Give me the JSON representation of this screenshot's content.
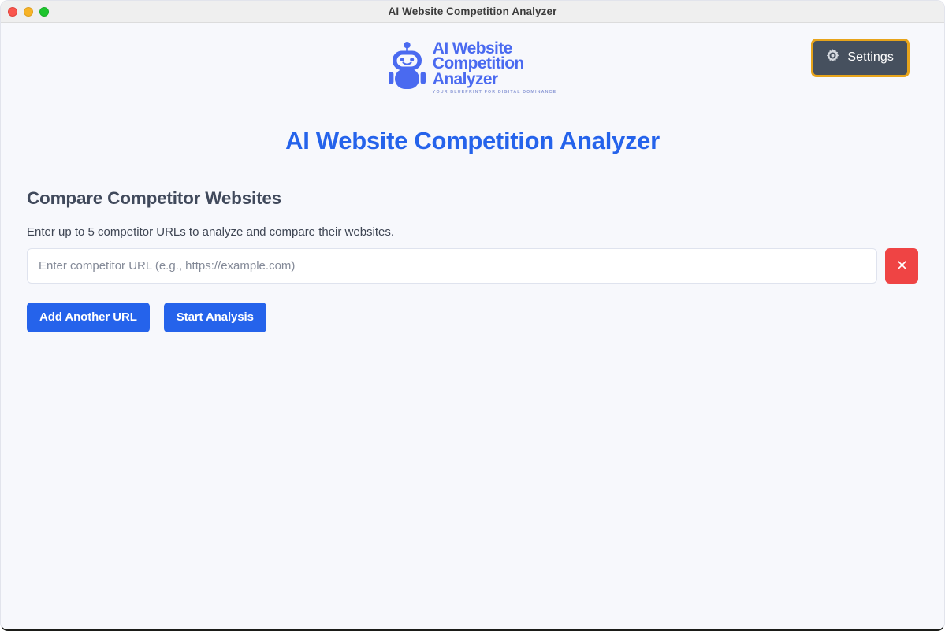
{
  "window": {
    "title": "AI Website Competition Analyzer",
    "traffic_lights": [
      "close",
      "minimize",
      "maximize"
    ]
  },
  "brand": {
    "logo_icon": "robot-mascot-icon",
    "name_line1": "AI Website",
    "name_line2": "Competition",
    "name_line3": "Analyzer",
    "tagline": "YOUR BLUEPRINT FOR DIGITAL DOMINANCE",
    "logo_color": "#4a6af0"
  },
  "header": {
    "settings_label": "Settings",
    "settings_icon": "gear-icon",
    "settings_bg": "#46505e",
    "settings_border": "#e7a41b"
  },
  "page": {
    "title": "AI Website Competition Analyzer",
    "title_color": "#2563eb"
  },
  "main": {
    "section_title": "Compare Competitor Websites",
    "section_description": "Enter up to 5 competitor URLs to analyze and compare their websites.",
    "url_inputs": [
      {
        "value": "",
        "placeholder": "Enter competitor URL (e.g., https://example.com)",
        "remove_icon": "close-icon",
        "remove_color": "#ef4444"
      }
    ],
    "add_url_label": "Add Another URL",
    "start_analysis_label": "Start Analysis",
    "button_color": "#2563eb"
  }
}
